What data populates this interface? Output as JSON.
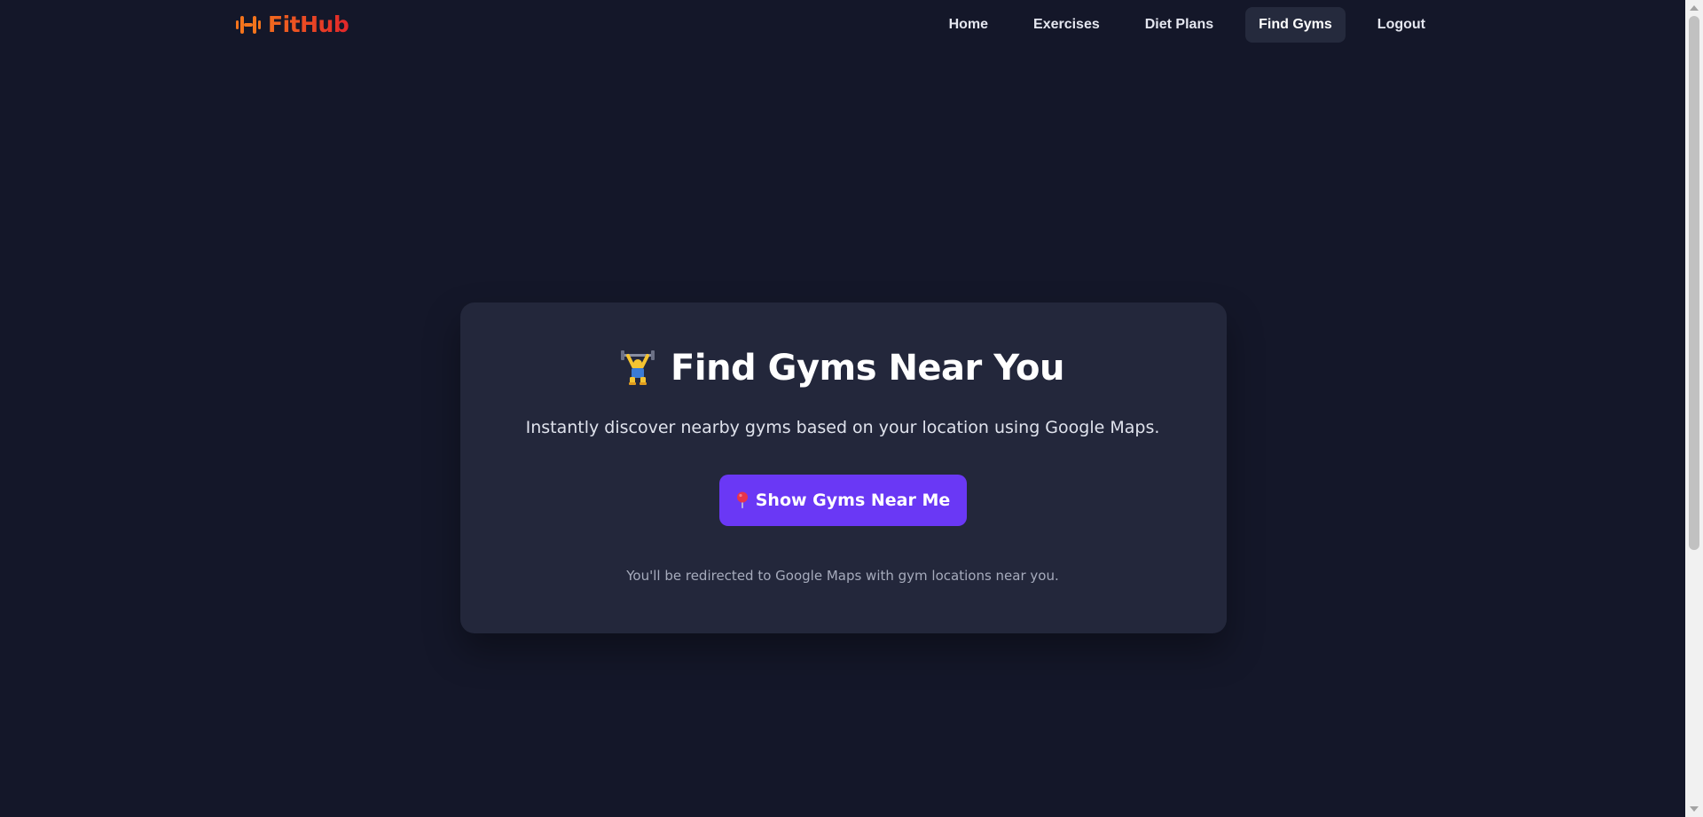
{
  "nav": {
    "brand": "FitHub",
    "links": [
      {
        "label": "Home",
        "active": false
      },
      {
        "label": "Exercises",
        "active": false
      },
      {
        "label": "Diet Plans",
        "active": false
      },
      {
        "label": "Find Gyms",
        "active": true
      },
      {
        "label": "Logout",
        "active": false
      }
    ]
  },
  "card": {
    "title": "Find Gyms Near You",
    "title_icon": "weight-lifter-icon",
    "description": "Instantly discover nearby gyms based on your location using Google Maps.",
    "button_label": "Show Gyms Near Me",
    "button_icon": "pin-icon",
    "note": "You'll be redirected to Google Maps with gym locations near you."
  },
  "colors": {
    "background": "#141729",
    "card": "#23273b",
    "accent_button": "#6a38f5",
    "brand_gradient_start": "#f06a1e",
    "brand_gradient_end": "#e2262a",
    "active_nav": "#252a3d"
  }
}
